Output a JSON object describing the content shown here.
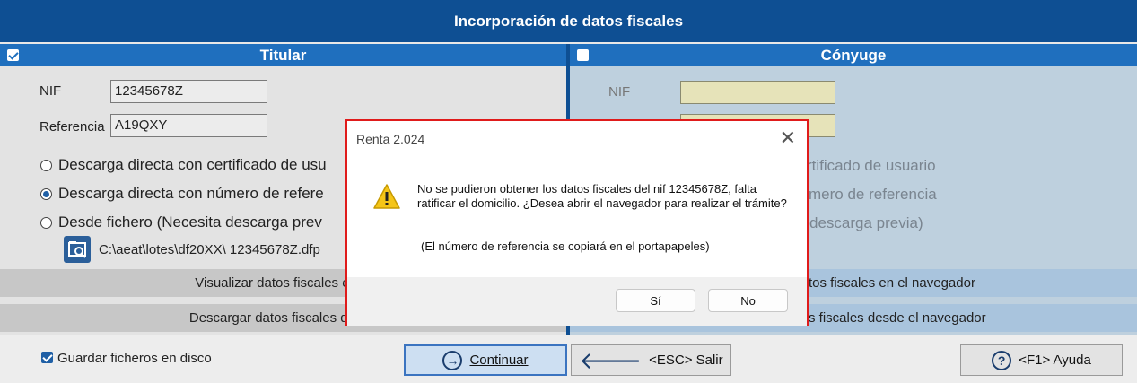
{
  "window": {
    "title": "Incorporación de datos fiscales"
  },
  "titular": {
    "header": "Titular",
    "nif_label": "NIF",
    "nif_value": "12345678Z",
    "ref_label": "Referencia",
    "ref_value": "A19QXY",
    "option1": "Descarga directa con certificado de usu",
    "option2": "Descarga directa con número de refere",
    "option3": "Desde fichero (Necesita descarga prev",
    "file_path": "C:\\aeat\\lotes\\df20XX\\ 12345678Z.dfp",
    "visualize": "Visualizar datos fiscales en el",
    "download": "Descargar datos fiscales desde"
  },
  "conyuge": {
    "header": "Cónyuge",
    "nif_label": "NIF",
    "option1_tail": "rtificado de usuario",
    "option2_tail": "mero de referencia",
    "option3_tail": "descarga previa)",
    "visualize_tail": "tos fiscales en el navegador",
    "download_tail": "s fiscales desde el navegador"
  },
  "bottom": {
    "save_files": "Guardar ficheros en disco",
    "continue": "Continuar",
    "exit": "<ESC> Salir",
    "help": "<F1> Ayuda",
    "help_icon": "?"
  },
  "dialog": {
    "title": "Renta 2.024",
    "close": "✕",
    "message": "No se pudieron obtener los datos fiscales del nif  12345678Z, falta ratificar el domicilio. ¿Desea abrir el navegador para realizar el trámite?",
    "note": "(El número de referencia se copiará en el portapapeles)",
    "yes": "Sí",
    "no": "No"
  },
  "icons": {
    "continue": "arrow-right-circle-icon",
    "exit": "arrow-left-icon",
    "help": "question-circle-icon",
    "warning": "warning-icon",
    "file": "folder-search-icon"
  },
  "colors": {
    "accent": "#0e4f93",
    "header": "#1f6fbe",
    "spouse_bg": "#bed0de",
    "dialog_border": "#e01b1b"
  }
}
